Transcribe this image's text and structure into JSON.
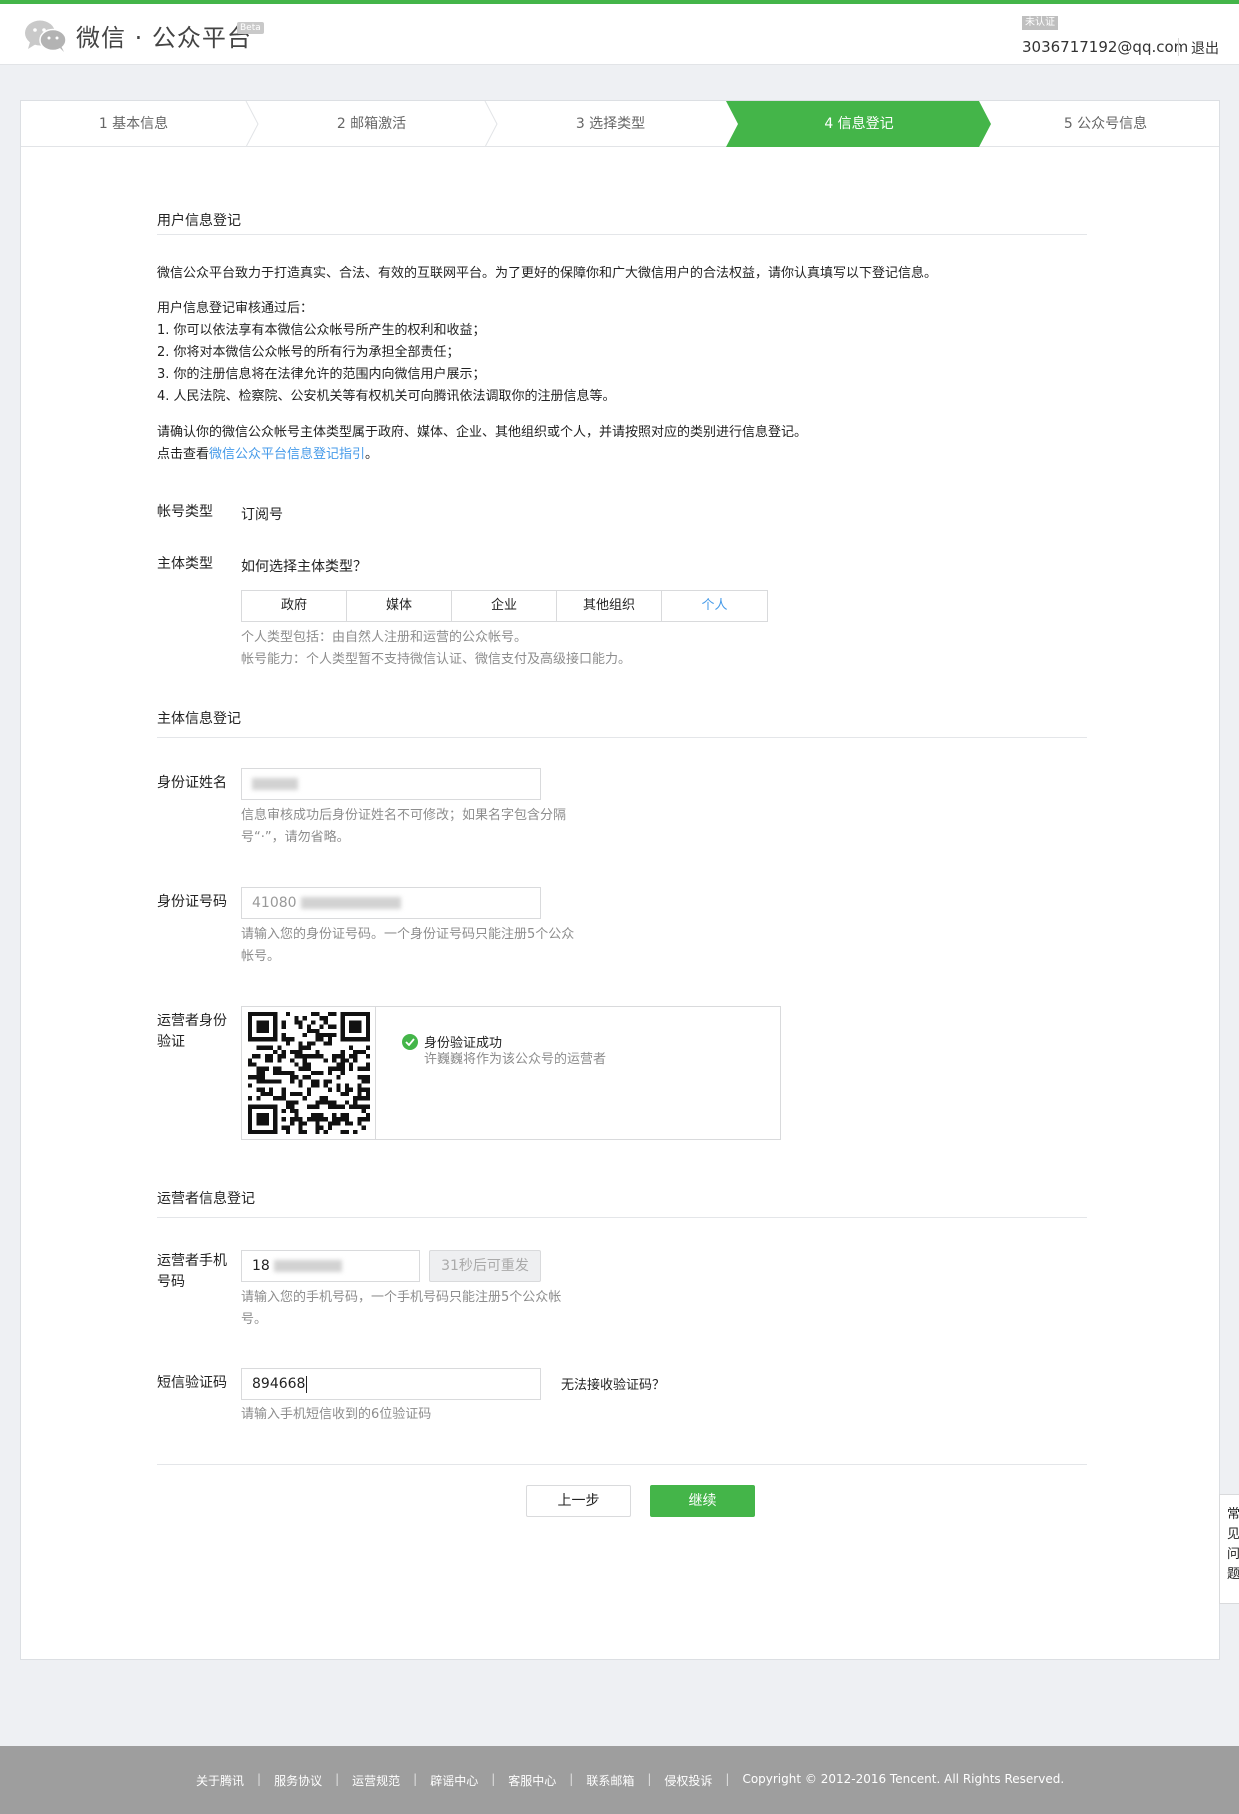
{
  "header": {
    "logo_text": "微信 · 公众平台",
    "beta": "Beta",
    "unverified": "未认证",
    "account": "3036717192@qq.com",
    "logout": "退出"
  },
  "steps": [
    "1 基本信息",
    "2 邮箱激活",
    "3 选择类型",
    "4 信息登记",
    "5 公众号信息"
  ],
  "active_step": "4 信息登记",
  "user_info": {
    "title": "用户信息登记",
    "intro": "微信公众平台致力于打造真实、合法、有效的互联网平台。为了更好的保障你和广大微信用户的合法权益，请你认真填写以下登记信息。",
    "after_title": "用户信息登记审核通过后：",
    "items": [
      "1. 你可以依法享有本微信公众帐号所产生的权利和收益；",
      "2. 你将对本微信公众帐号的所有行为承担全部责任；",
      "3. 你的注册信息将在法律允许的范围内向微信用户展示；",
      "4. 人民法院、检察院、公安机关等有权机关可向腾讯依法调取你的注册信息等。"
    ],
    "confirm_text": "请确认你的微信公众帐号主体类型属于政府、媒体、企业、其他组织或个人，并请按照对应的类别进行信息登记。",
    "guide_prefix": "点击查看",
    "guide_link": "微信公众平台信息登记指引",
    "guide_suffix": "。"
  },
  "account_type": {
    "label": "帐号类型",
    "value": "订阅号"
  },
  "subject_type": {
    "label": "主体类型",
    "help_link": "如何选择主体类型？",
    "options": [
      "政府",
      "媒体",
      "企业",
      "其他组织",
      "个人"
    ],
    "selected": "个人",
    "tip1": "个人类型包括：由自然人注册和运营的公众帐号。",
    "tip2": "帐号能力：个人类型暂不支持微信认证、微信支付及高级接口能力。"
  },
  "subject_info": {
    "title": "主体信息登记",
    "id_name_label": "身份证姓名",
    "id_name_tip1": "信息审核成功后身份证姓名不可修改；如果名字包含分隔",
    "id_name_tip2": "号“·”，请勿省略。",
    "id_number_label": "身份证号码",
    "id_number_prefix": "41080",
    "id_number_tip1": "请输入您的身份证号码。一个身份证号码只能注册5个公众",
    "id_number_tip2": "帐号。",
    "operator_verify_label1": "运营者身份",
    "operator_verify_label2": "验证",
    "verify_status": "身份验证成功",
    "verify_desc": "许巍巍将作为该公众号的运营者"
  },
  "operator_info": {
    "title": "运营者信息登记",
    "phone_label1": "运营者手机",
    "phone_label2": "号码",
    "phone_prefix": "18",
    "resend_button": "31秒后可重发",
    "phone_tip1": "请输入您的手机号码，一个手机号码只能注册5个公众帐",
    "phone_tip2": "号。",
    "sms_label": "短信验证码",
    "sms_value": "894668",
    "sms_help": "无法接收验证码？",
    "sms_tip": "请输入手机短信收到的6位验证码"
  },
  "actions": {
    "prev": "上一步",
    "next": "继续"
  },
  "float_tab": [
    "常",
    "见",
    "问",
    "题"
  ],
  "footer": {
    "links": [
      "关于腾讯",
      "服务协议",
      "运营规范",
      "辟谣中心",
      "客服中心",
      "联系邮箱",
      "侵权投诉"
    ],
    "copyright": "Copyright © 2012-2016 Tencent. All Rights Reserved."
  },
  "colors": {
    "brand_green": "#44b549",
    "link_blue": "#459ae9",
    "footer_gray": "#9e9e9e"
  }
}
